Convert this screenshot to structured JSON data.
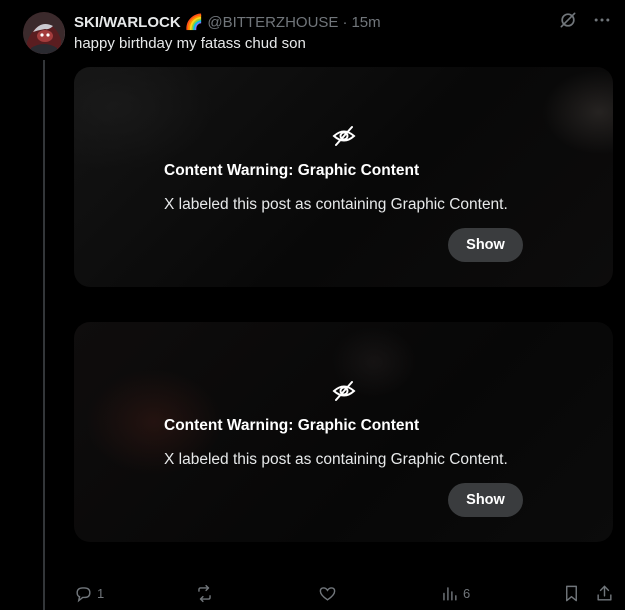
{
  "post": {
    "display_name": "SKI/WARLOCK",
    "name_emoji": "🌈",
    "handle": "@BITTERZHOUSE",
    "separator": "·",
    "time": "15m",
    "text": "happy birthday my fatass chud son"
  },
  "top_actions": {
    "grok_icon": "grok-icon",
    "more_icon": "more-icon",
    "more_label": "···"
  },
  "media": [
    {
      "icon": "eye-off-icon",
      "title": "Content Warning: Graphic Content",
      "description": "X labeled this post as containing Graphic Content.",
      "button": "Show"
    },
    {
      "icon": "eye-off-icon",
      "title": "Content Warning: Graphic Content",
      "description": "X labeled this post as containing Graphic Content.",
      "button": "Show"
    }
  ],
  "actions": {
    "reply_count": "1",
    "retweet_count": "",
    "like_count": "",
    "views_count": "6"
  },
  "colors": {
    "background": "#000000",
    "text": "#e7e9ea",
    "muted": "#71767b",
    "button_bg": "#3a3c3e"
  }
}
